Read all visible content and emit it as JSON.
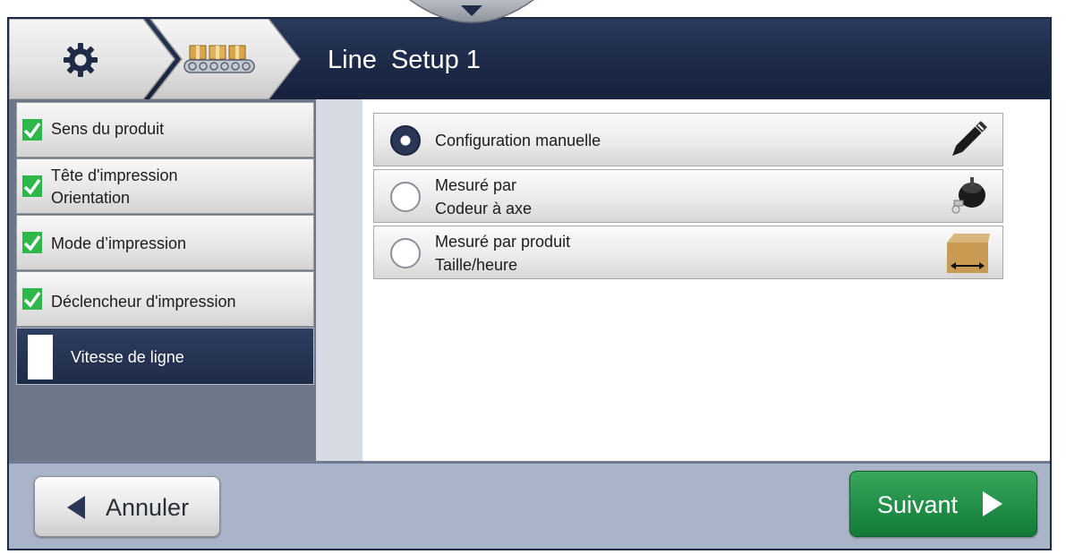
{
  "header": {
    "title": "Line  Setup 1",
    "icons": [
      "gear-icon",
      "conveyor-icon",
      "chevron-down-icon"
    ]
  },
  "steps": [
    {
      "line1": "Sens du produit",
      "line2": "",
      "status": "done"
    },
    {
      "line1": "Tête d'impression",
      "line2": "Orientation",
      "status": "done"
    },
    {
      "line1": "Mode d’impression",
      "line2": "",
      "status": "done"
    },
    {
      "line1": "Déclencheur d'impression",
      "line2": "",
      "status": "done"
    },
    {
      "line1": "Vitesse de ligne",
      "line2": "",
      "status": "active"
    }
  ],
  "options": [
    {
      "line1": "Configuration manuelle",
      "line2": "",
      "selected": true,
      "icon": "pencil-icon"
    },
    {
      "line1": "Mesuré par",
      "line2": "Codeur à axe",
      "selected": false,
      "icon": "shaft-encoder-icon"
    },
    {
      "line1": "Mesuré par produit",
      "line2": "Taille/heure",
      "selected": false,
      "icon": "product-box-icon"
    }
  ],
  "footer": {
    "cancel_label": "Annuler",
    "next_label": "Suivant"
  },
  "colors": {
    "header_bg": "#1b2846",
    "check_green": "#2fb84a",
    "next_green": "#23914a"
  }
}
